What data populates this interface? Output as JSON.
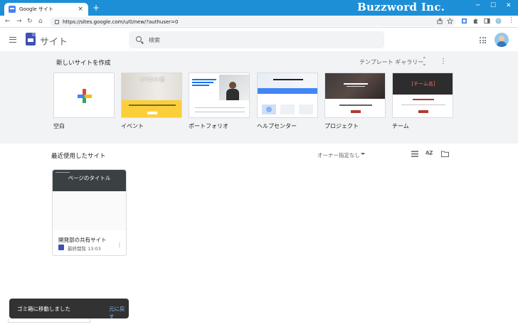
{
  "browser": {
    "tab_title": "Google サイト",
    "tab_close": "×",
    "new_tab": "+",
    "url": "https://sites.google.com/u/0/new/?authuser=0",
    "window_controls": [
      "─",
      "☐",
      "✕"
    ],
    "watermark": "Buzzword Inc."
  },
  "header": {
    "app_name": "サイト",
    "search_placeholder": "検索"
  },
  "gallery": {
    "title": "新しいサイトを作成",
    "gallery_button": "テンプレート ギャラリー",
    "templates": [
      {
        "label": "空白"
      },
      {
        "label": "イベント",
        "thumb_title": "イベント名"
      },
      {
        "label": "ポートフォリオ"
      },
      {
        "label": "ヘルプセンター"
      },
      {
        "label": "プロジェクト"
      },
      {
        "label": "チーム",
        "thumb_title": "[チーム名]"
      }
    ]
  },
  "recent": {
    "title": "最近使用したサイト",
    "owner_filter": "オーナー指定なし",
    "sites": [
      {
        "thumb_title": "ページのタイトル",
        "name": "開発部の共有サイト",
        "meta": "最終閲覧 13:03"
      }
    ]
  },
  "snackbar": {
    "message": "ゴミ箱に移動しました",
    "action": "元に戻す"
  },
  "colors": {
    "chrome_blue": "#1d8fd6",
    "sites_brand": "#3f51b5",
    "gallery_bg": "#f1f3f4",
    "event_yellow": "#fbcf3b",
    "team_red": "#b23a34"
  }
}
